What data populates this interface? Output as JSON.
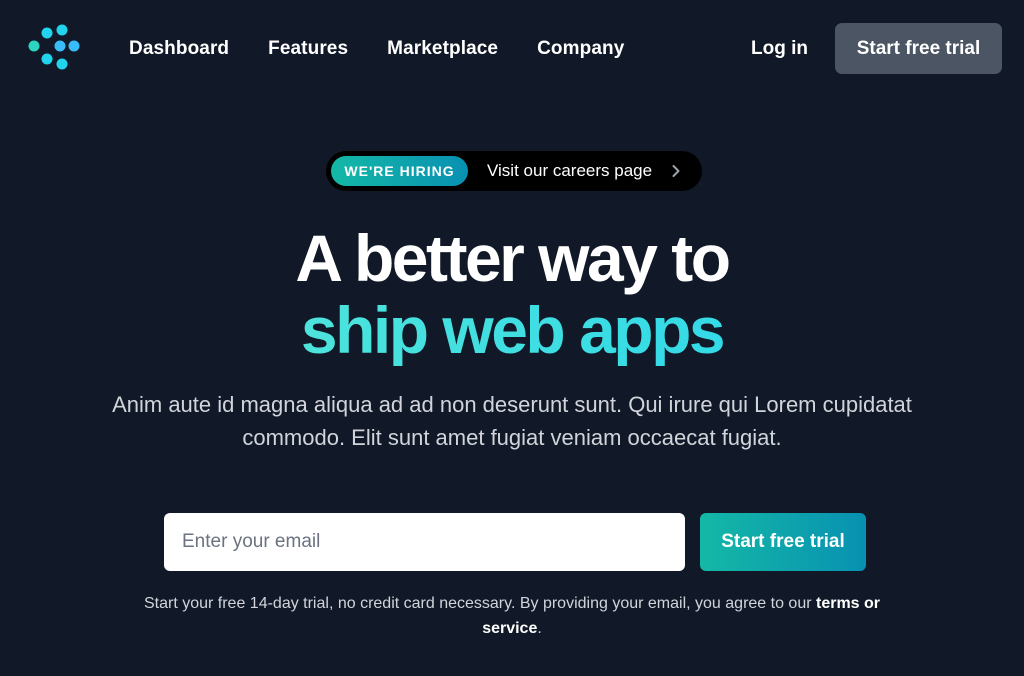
{
  "nav": {
    "logo_icon": "dots-chevron-logo",
    "links": [
      {
        "label": "Dashboard"
      },
      {
        "label": "Features"
      },
      {
        "label": "Marketplace"
      },
      {
        "label": "Company"
      }
    ],
    "login_label": "Log in",
    "cta_label": "Start free trial"
  },
  "hero": {
    "badge": {
      "tag": "WE'RE HIRING",
      "text": "Visit our careers page",
      "icon": "chevron-right-icon"
    },
    "headline_line1": "A better way to",
    "headline_line2": "ship web apps",
    "subtext": "Anim aute id magna aliqua ad ad non deserunt sunt. Qui irure qui Lorem cupidatat commodo. Elit sunt amet fugiat veniam occaecat fugiat.",
    "email_placeholder": "Enter your email",
    "email_value": "",
    "submit_label": "Start free trial",
    "fineprint_text": "Start your free 14-day trial, no credit card necessary. By providing your email, you agree to our ",
    "fineprint_link": "terms or service",
    "fineprint_end": "."
  },
  "colors": {
    "background": "#111827",
    "accent_start": "#14b8a6",
    "accent_end": "#0891b2",
    "nav_cta_bg": "#4b5563"
  }
}
